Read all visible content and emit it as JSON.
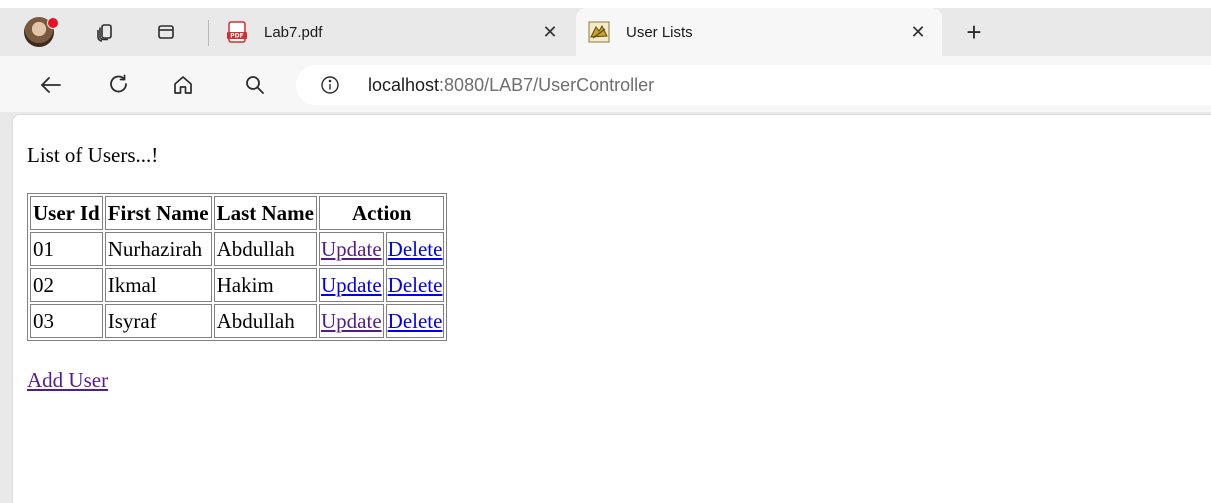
{
  "tabs": [
    {
      "title": "Lab7.pdf",
      "close_glyph": "✕",
      "favicon": "pdf-icon"
    },
    {
      "title": "User Lists",
      "close_glyph": "✕",
      "favicon": "tomcat-icon",
      "active": true
    }
  ],
  "tabstrip": {
    "new_tab_glyph": "+"
  },
  "address": {
    "host": "localhost",
    "rest": ":8080/LAB7/UserController"
  },
  "page": {
    "heading": "List of Users...!",
    "table": {
      "headers": [
        "User Id",
        "First Name",
        "Last Name",
        "Action"
      ],
      "rows": [
        {
          "id": "01",
          "first": "Nurhazirah",
          "last": "Abdullah",
          "update": "Update",
          "delete": "Delete"
        },
        {
          "id": "02",
          "first": "Ikmal",
          "last": "Hakim",
          "update": "Update",
          "delete": "Delete"
        },
        {
          "id": "03",
          "first": "Isyraf",
          "last": "Abdullah",
          "update": "Update",
          "delete": "Delete"
        }
      ]
    },
    "add_user": "Add User"
  },
  "colors": {
    "link": "#0000ee",
    "visited_link": "#551a8b",
    "profile_badge": "#e81123",
    "pdf_icon": "#d32f2f"
  }
}
